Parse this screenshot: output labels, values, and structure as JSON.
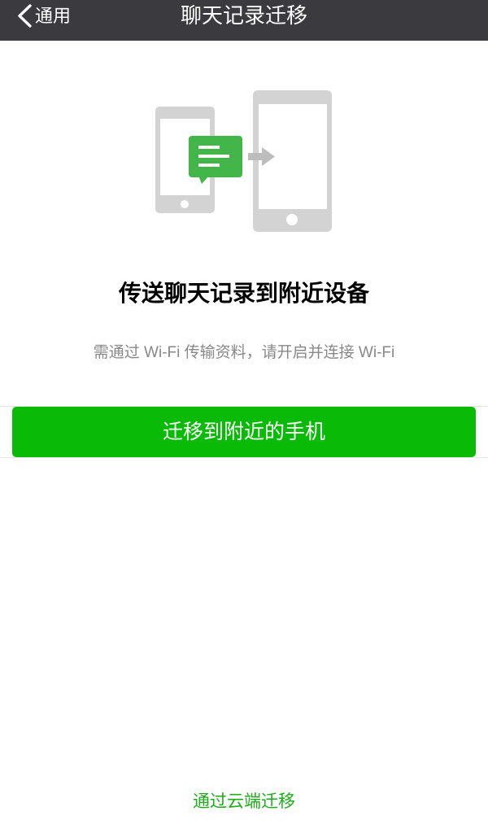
{
  "nav": {
    "back_label": "通用",
    "title": "聊天记录迁移"
  },
  "main": {
    "heading": "传送聊天记录到附近设备",
    "subtitle": "需通过 Wi-Fi 传输资料，请开启并连接 Wi-Fi",
    "migrate_button_label": "迁移到附近的手机"
  },
  "footer": {
    "cloud_migration_link": "通过云端迁移"
  },
  "icons": {
    "back": "chevron-left-icon",
    "source_device": "phone-icon",
    "message": "chat-bubble-icon",
    "direction": "arrow-right-icon",
    "target_device": "phone-icon"
  },
  "colors": {
    "nav_background": "#3a3a3f",
    "nav_text": "#ffffff",
    "primary_green": "#09bb07",
    "link_green": "#1aad19",
    "bubble_green": "#43b649",
    "device_gray": "#d3d3d3",
    "arrow_gray": "#bdbdbd",
    "subtitle_gray": "#888888",
    "divider": "#e5e5e5"
  }
}
